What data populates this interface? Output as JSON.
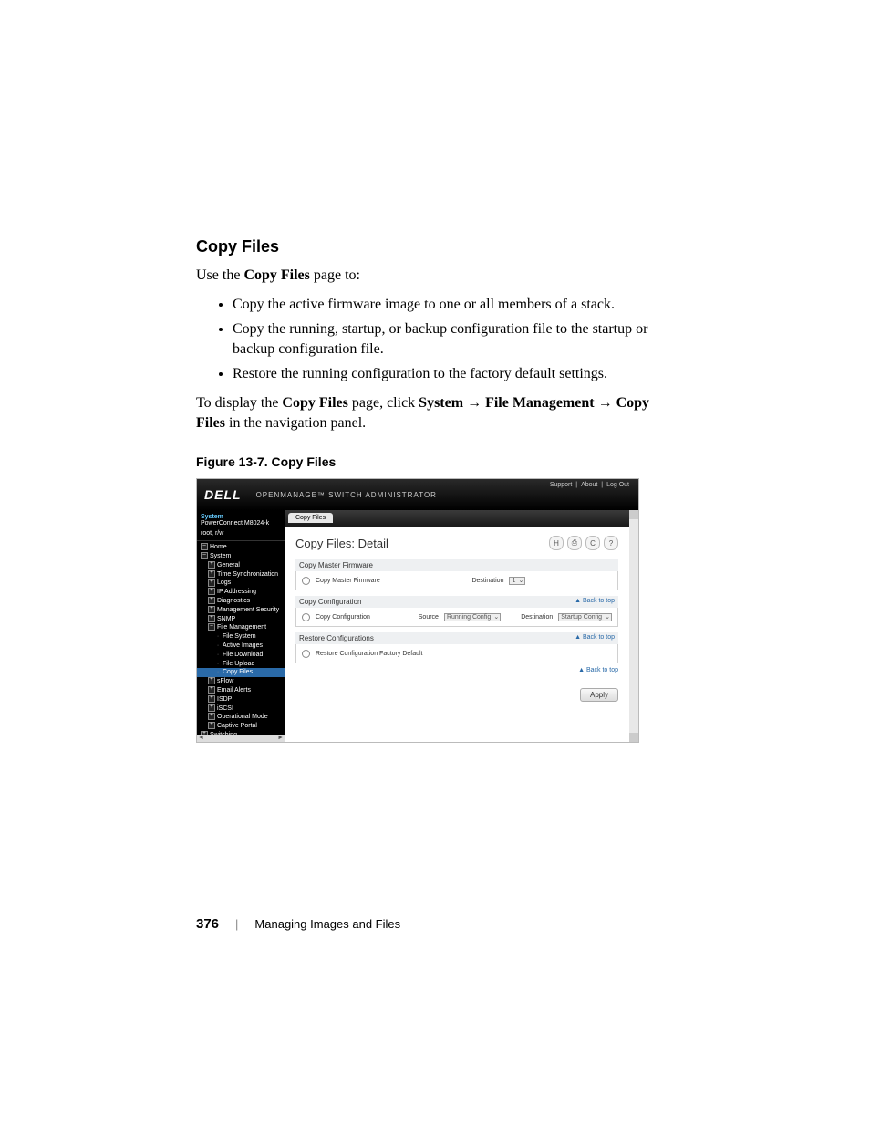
{
  "heading": "Copy Files",
  "intro_text_1": "Use the ",
  "intro_bold_1": "Copy Files",
  "intro_text_2": " page to:",
  "bullets": [
    "Copy the active firmware image to one or all members of a stack.",
    "Copy the running, startup, or backup configuration file to the startup or backup configuration file.",
    "Restore the running configuration to the factory default settings."
  ],
  "nav_text_1": "To display the ",
  "nav_bold_1": "Copy Files",
  "nav_text_2": " page, click ",
  "nav_bold_2": "System",
  "arrow": " → ",
  "nav_bold_3": "File Management",
  "nav_bold_4": "Copy Files",
  "nav_text_3": " in the navigation panel.",
  "figure_caption": "Figure 13-7.    Copy Files",
  "screenshot": {
    "logo": "DELL",
    "app_title": "OPENMANAGE™ SWITCH ADMINISTRATOR",
    "top_links": [
      "Support",
      "About",
      "Log Out"
    ],
    "sidebar_header": "System",
    "sidebar_sub1": "PowerConnect M8024-k",
    "sidebar_sub2": "root, r/w",
    "tree": {
      "home": "Home",
      "system": "System",
      "general": "General",
      "time_sync": "Time Synchronization",
      "logs": "Logs",
      "ip_addr": "IP Addressing",
      "diag": "Diagnostics",
      "mgmt_sec": "Management Security",
      "snmp": "SNMP",
      "file_mgmt": "File Management",
      "file_system": "File System",
      "active_images": "Active Images",
      "file_download": "File Download",
      "file_upload": "File Upload",
      "copy_files": "Copy Files",
      "sflow": "sFlow",
      "email_alerts": "Email Alerts",
      "isdp": "ISDP",
      "iscsi": "iSCSI",
      "op_mode": "Operational Mode",
      "captive": "Captive Portal",
      "switching": "Switching"
    },
    "tab": "Copy Files",
    "page_title": "Copy Files: Detail",
    "section1": {
      "header": "Copy Master Firmware",
      "option": "Copy Master Firmware",
      "dest_label": "Destination",
      "dest_value": "1"
    },
    "section2": {
      "header": "Copy Configuration",
      "back": "▲ Back to top",
      "option": "Copy Configuration",
      "src_label": "Source",
      "src_value": "Running Config",
      "dest_label": "Destination",
      "dest_value": "Startup Config"
    },
    "section3": {
      "header": "Restore Configurations",
      "back": "▲ Back to top",
      "option": "Restore Configuration Factory Default",
      "back2": "▲ Back to top"
    },
    "apply": "Apply"
  },
  "footer": {
    "page_number": "376",
    "chapter": "Managing Images and Files"
  }
}
